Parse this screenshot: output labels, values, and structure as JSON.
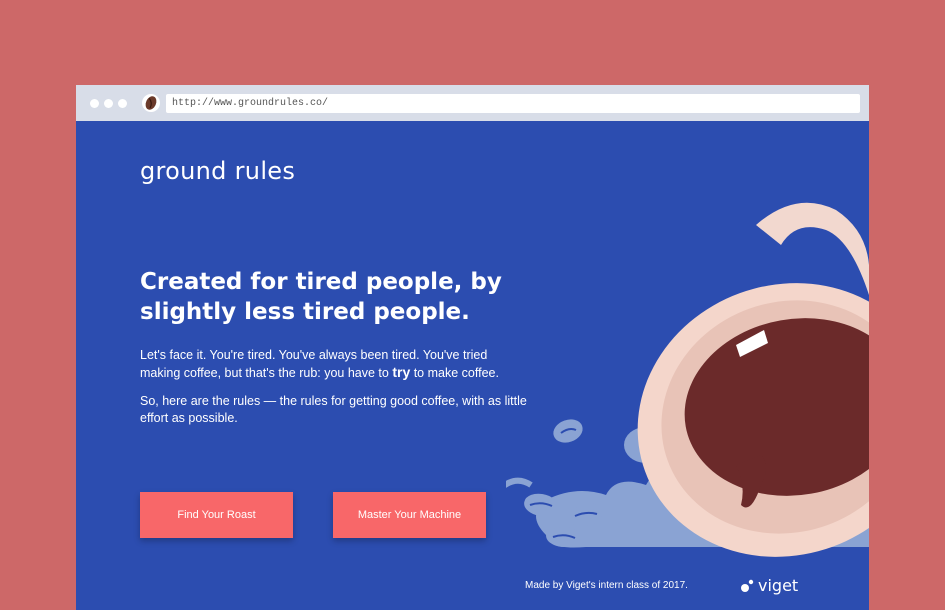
{
  "browser": {
    "url": "http://www.groundrules.co/",
    "favicon_icon": "coffee-bean-icon"
  },
  "page": {
    "logo": "ground rules",
    "headline": "Created for tired people, by slightly less tired people.",
    "paragraph1_before": "Let's face it. You're tired. You've always been tired. You've tried making coffee, but that's the rub: you have to ",
    "paragraph1_emphasis": "try",
    "paragraph1_after": " to make coffee.",
    "paragraph2": "So, here are the rules — the rules for getting good coffee, with as little effort as possible.",
    "buttons": {
      "find_roast": "Find Your Roast",
      "master_machine": "Master Your Machine"
    },
    "footer": {
      "credit": "Made by Viget's intern class of 2017.",
      "brand": "viget"
    }
  },
  "colors": {
    "background": "#cd6868",
    "page_blue": "#2c4db0",
    "button_coral": "#f86769",
    "coffee": "#6b2a2a",
    "spill": "#8aa3d3"
  }
}
